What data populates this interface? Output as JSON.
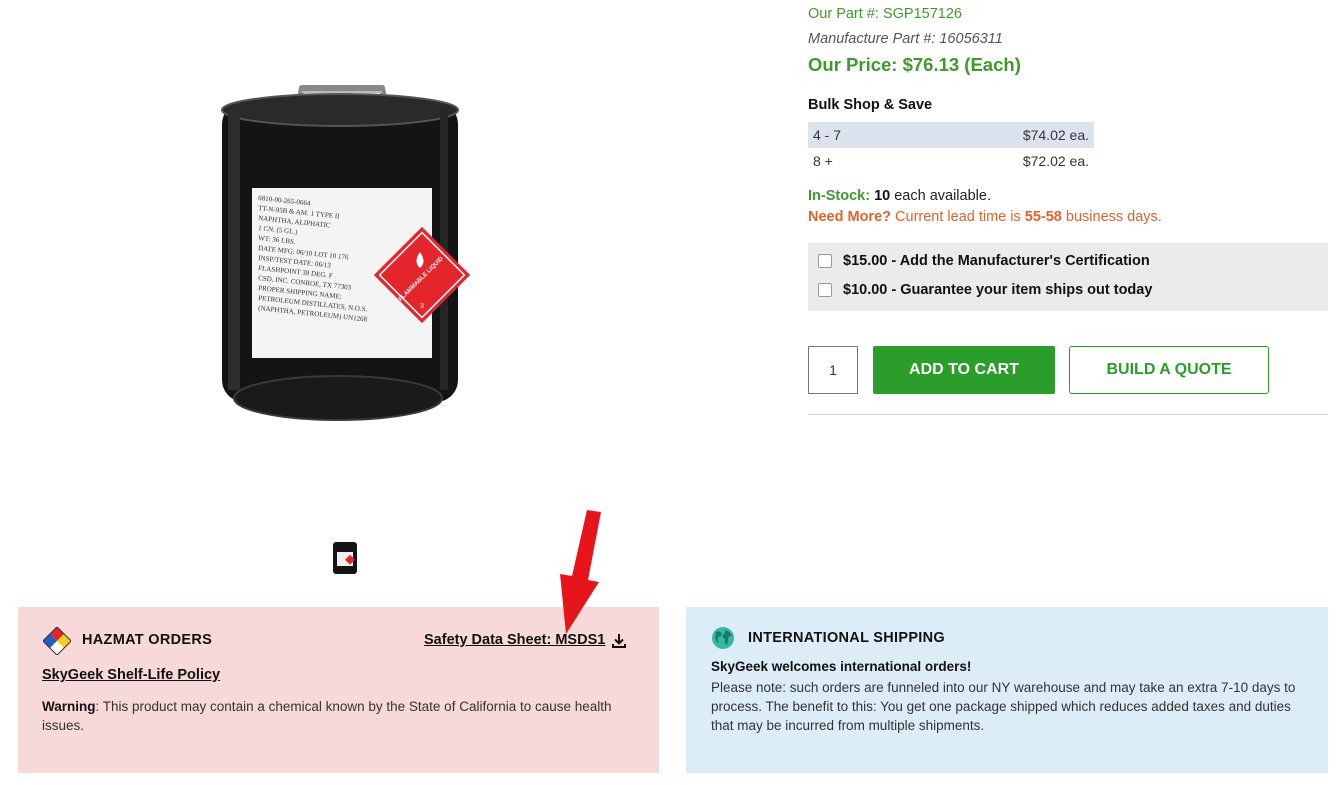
{
  "product": {
    "our_part": "Our Part #: SGP157126",
    "manufacture_part": "Manufacture Part #: 16056311",
    "our_price": "Our Price: $76.13 (Each)",
    "image_label_lines": [
      "6810-00-265-0664",
      "TT-N-95B & AM. 1 TYPE II",
      "NAPHTHA, ALIPHATIC",
      "1 CN. (5 GL.)",
      "WT: 36 LBS.",
      "DATE MFG: 06/10    LOT 10 176",
      "INSP/TEST DATE: 06/13",
      "FLASHPOINT 38 DEG. F",
      "CSD, INC. CONROE, TX 77303",
      "PROPER SHIPPING NAME:",
      "PETROLEUM DISTILLATES, N.O.S.",
      "(NAPHTHA, PETROLEUM) UN1268"
    ],
    "diamond_text": "FLAMMABLE LIQUID",
    "diamond_class": "3"
  },
  "bulk": {
    "title": "Bulk Shop & Save",
    "rows": [
      {
        "qty": "4 - 7",
        "price": "$74.02 ea."
      },
      {
        "qty": "8 +",
        "price": "$72.02 ea."
      }
    ]
  },
  "stock": {
    "label": "In-Stock:",
    "count": "10",
    "suffix": " each available."
  },
  "need_more": {
    "label": "Need More?",
    "text": " Current lead time is ",
    "days": "55-58",
    "suffix": " business days."
  },
  "addons": [
    {
      "label": "$15.00 - Add the Manufacturer's Certification"
    },
    {
      "label": "$10.00 - Guarantee your item ships out today"
    }
  ],
  "cart": {
    "quantity": "1",
    "add_to_cart": "ADD TO CART",
    "build_quote": "BUILD A QUOTE"
  },
  "hazmat": {
    "title": "HAZMAT ORDERS",
    "sds_link": "Safety Data Sheet: MSDS1",
    "shelf_life_link": "SkyGeek Shelf-Life Policy",
    "warning_label": "Warning",
    "warning_text": ": This product may contain a chemical known by the State of California to cause health issues."
  },
  "international": {
    "title": "INTERNATIONAL SHIPPING",
    "welcome": "SkyGeek welcomes international orders!",
    "note": "Please note: such orders are funneled into our NY warehouse and may take an extra 7-10 days to process. The benefit to this: You get one package shipped which reduces added taxes and duties that may be incurred from multiple shipments."
  },
  "icons": {
    "hazmat": "nfpa-diamond-icon",
    "download": "download-icon",
    "globe": "globe-icon",
    "annotation": "red-arrow"
  },
  "colors": {
    "brand_green": "#2a9d2a",
    "price_green": "#3f9a2c",
    "lead_orange": "#e0632a",
    "hazmat_bg": "#f8d9d9",
    "intl_bg": "#dcedf8",
    "arrow_red": "#e8141b"
  }
}
